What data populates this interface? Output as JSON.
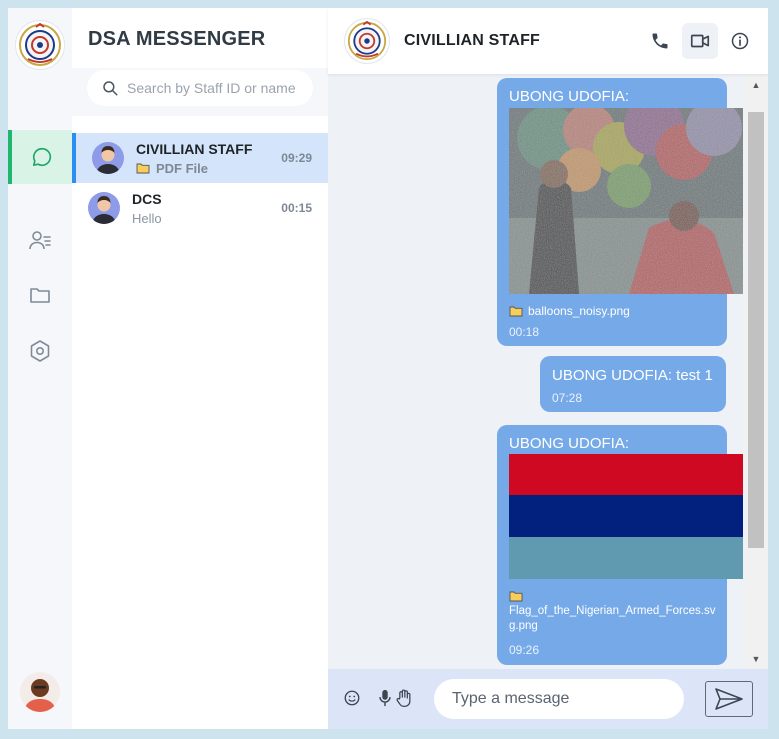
{
  "app": {
    "title": "DSA MESSENGER"
  },
  "search": {
    "placeholder": "Search by Staff ID or name"
  },
  "rail": {
    "items": [
      {
        "icon": "chat-bubble-icon",
        "active": true
      },
      {
        "icon": "contacts-icon",
        "active": false
      },
      {
        "icon": "folder-icon",
        "active": false
      },
      {
        "icon": "settings-hexagon-icon",
        "active": false
      }
    ]
  },
  "chats": [
    {
      "name": "CIVILLIAN STAFF",
      "preview": "PDF File",
      "time": "09:29",
      "active": true
    },
    {
      "name": "DCS",
      "preview": "Hello",
      "time": "00:15",
      "active": false
    }
  ],
  "conversation": {
    "name": "CIVILLIAN STAFF",
    "messages": [
      {
        "sender": "UBONG UDOFIA:",
        "type": "image",
        "file": "balloons_noisy.png",
        "time": "00:18"
      },
      {
        "sender": "UBONG UDOFIA: test 1",
        "type": "text",
        "time": "07:28"
      },
      {
        "sender": "UBONG UDOFIA:",
        "type": "image",
        "file_line1": "Flag_of_the_Nigerian_Armed_Forces.sv",
        "file_line2": "g.png",
        "time": "09:26"
      }
    ]
  },
  "composer": {
    "placeholder": "Type a message"
  },
  "colors": {
    "bubble": "#76a9e8",
    "active_rail": "#d9f4e6",
    "active_chat": "#d3e4fb",
    "accent_green": "#21b56f",
    "accent_blue": "#2b8ef2"
  }
}
